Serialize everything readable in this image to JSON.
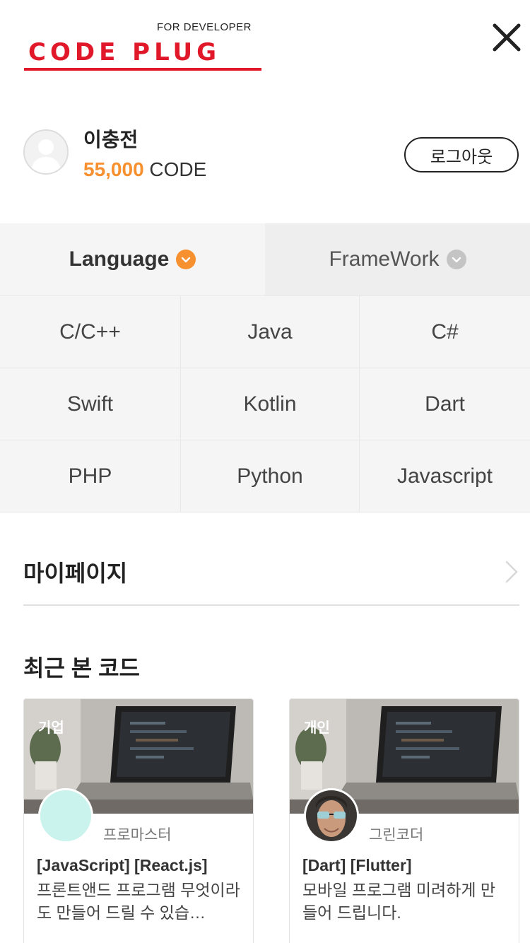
{
  "logo": {
    "tagline": "FOR DEVELOPER",
    "word1": "CODE",
    "word2": "PLUG"
  },
  "profile": {
    "name": "이충전",
    "points": "55,000",
    "points_unit": " CODE",
    "logout_label": "로그아웃"
  },
  "tabs": [
    {
      "label": "Language",
      "active": true
    },
    {
      "label": "FrameWork",
      "active": false
    }
  ],
  "languages": [
    "C/C++",
    "Java",
    "C#",
    "Swift",
    "Kotlin",
    "Dart",
    "PHP",
    "Python",
    "Javascript"
  ],
  "menu": {
    "mypage_label": "마이페이지"
  },
  "recent": {
    "title": "최근 본 코드",
    "cards": [
      {
        "badge": "기업",
        "author": "프로마스터",
        "tags": "[JavaScript]  [React.js]",
        "desc": "프론트앤드 프로그램 무엇이라도 만들어 드릴 수 있습…"
      },
      {
        "badge": "개인",
        "author": "그린코더",
        "tags": "[Dart]  [Flutter]",
        "desc": "모바일 프로그램 미려하게 만들어 드립니다."
      }
    ]
  },
  "colors": {
    "accent": "#f7902f",
    "brand_red": "#e0182a",
    "avatar_mint": "#c9f3ec"
  }
}
